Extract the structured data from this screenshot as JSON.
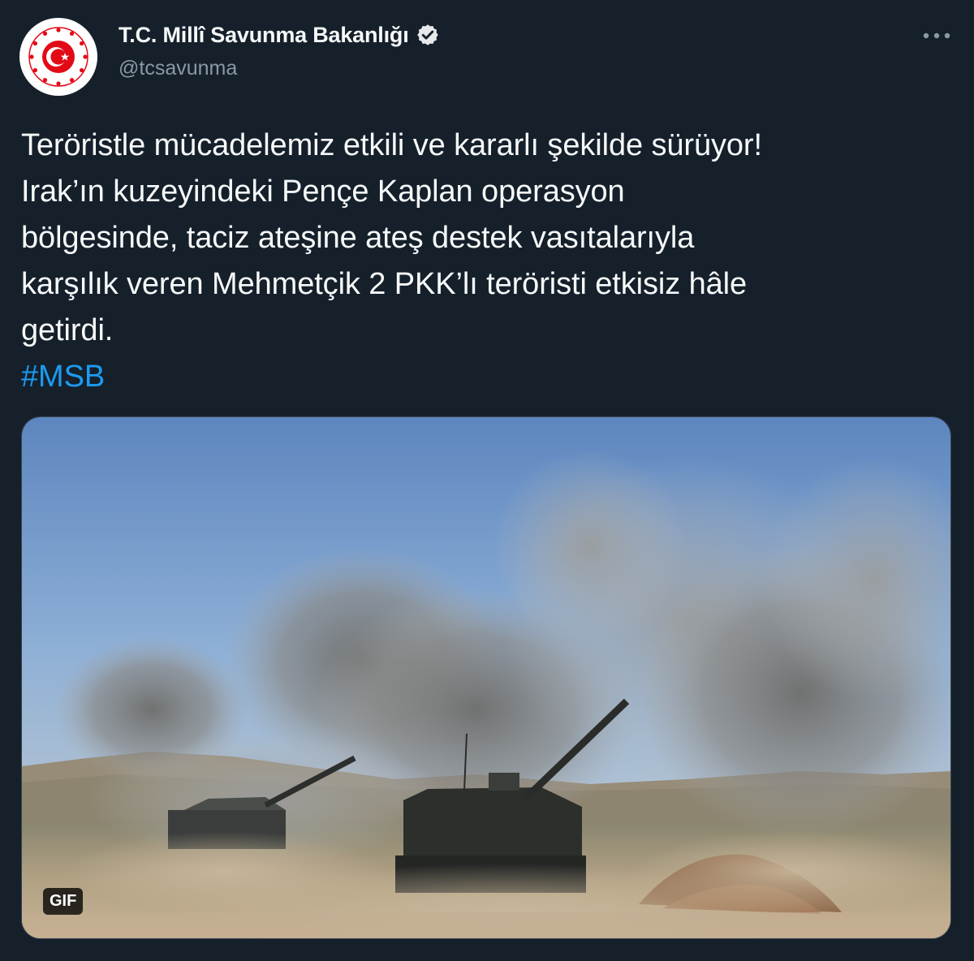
{
  "author": {
    "display_name": "T.C. Millî Savunma Bakanlığı",
    "handle": "@tcsavunma",
    "verified": true,
    "avatar_icon": "ministry-emblem-icon"
  },
  "menu": {
    "icon": "more-options-icon"
  },
  "tweet": {
    "lines": [
      "Teröristle mücadelemiz etkili ve kararlı şekilde sürüyor!",
      "Irak’ın kuzeyindeki Pençe Kaplan operasyon",
      "bölgesinde, taciz ateşine ateş destek vasıtalarıyla",
      "karşılık veren Mehmetçik 2 PKK’lı teröristi etkisiz hâle",
      "getirdi."
    ],
    "hashtag": "#MSB"
  },
  "media": {
    "type": "gif",
    "badge": "GIF"
  },
  "colors": {
    "background": "#15202b",
    "text": "#f7f9f9",
    "secondary": "#8b98a5",
    "link": "#1d9bf0",
    "emblem_red": "#e30a17"
  }
}
